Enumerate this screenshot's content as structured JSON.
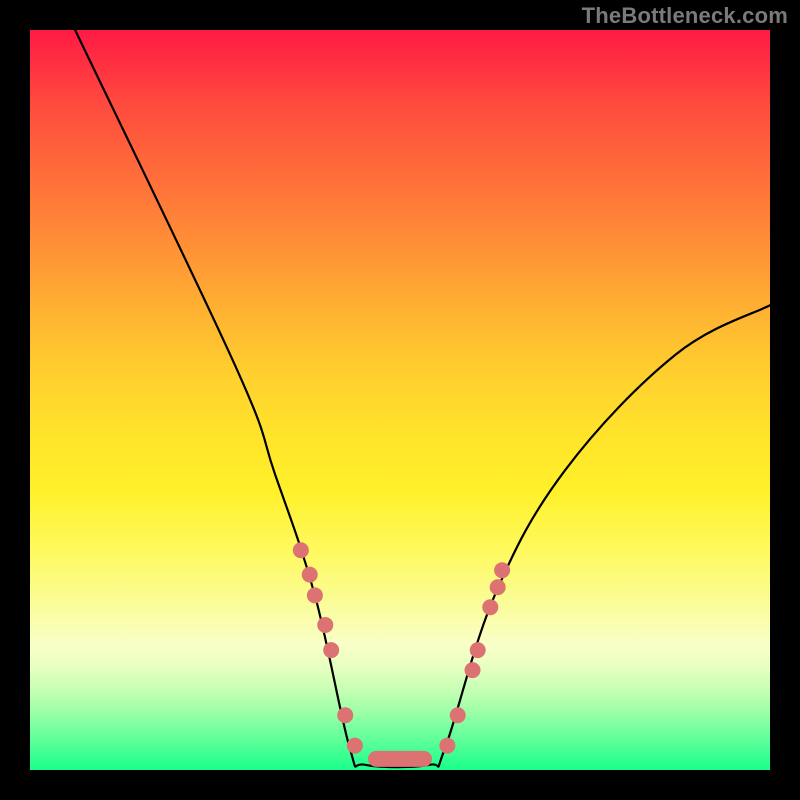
{
  "watermark": "TheBottleneck.com",
  "chart_data": {
    "type": "line",
    "title": "",
    "xlabel": "",
    "ylabel": "",
    "xlim": [
      0,
      100
    ],
    "ylim": [
      0,
      100
    ],
    "grid": false,
    "points_curve1": [
      {
        "x": 6.1,
        "y": 100
      },
      {
        "x": 27.7,
        "y": 54.7
      },
      {
        "x": 33.1,
        "y": 40.0
      },
      {
        "x": 38.5,
        "y": 23.6
      },
      {
        "x": 43.2,
        "y": 3.0
      },
      {
        "x": 45.3,
        "y": 0.7
      },
      {
        "x": 54.0,
        "y": 0.7
      },
      {
        "x": 56.1,
        "y": 3.0
      },
      {
        "x": 62.8,
        "y": 23.6
      },
      {
        "x": 72.3,
        "y": 40.5
      },
      {
        "x": 87.2,
        "y": 56.1
      },
      {
        "x": 100,
        "y": 62.8
      }
    ],
    "markers_left": [
      {
        "x": 36.6,
        "y": 29.7
      },
      {
        "x": 37.8,
        "y": 26.4
      },
      {
        "x": 38.5,
        "y": 23.6
      },
      {
        "x": 39.9,
        "y": 19.6
      },
      {
        "x": 40.7,
        "y": 16.2
      },
      {
        "x": 42.6,
        "y": 7.4
      },
      {
        "x": 43.9,
        "y": 3.3
      }
    ],
    "markers_right": [
      {
        "x": 56.4,
        "y": 3.3
      },
      {
        "x": 57.8,
        "y": 7.4
      },
      {
        "x": 59.8,
        "y": 13.5
      },
      {
        "x": 60.5,
        "y": 16.2
      },
      {
        "x": 62.2,
        "y": 22.0
      },
      {
        "x": 63.2,
        "y": 24.7
      },
      {
        "x": 63.8,
        "y": 27.0
      }
    ],
    "flat_segment": [
      {
        "x": 46.0,
        "y": 1.5
      },
      {
        "x": 54.0,
        "y": 1.5
      }
    ],
    "marker_color": "#dc7272",
    "marker_radius_px": 8
  }
}
